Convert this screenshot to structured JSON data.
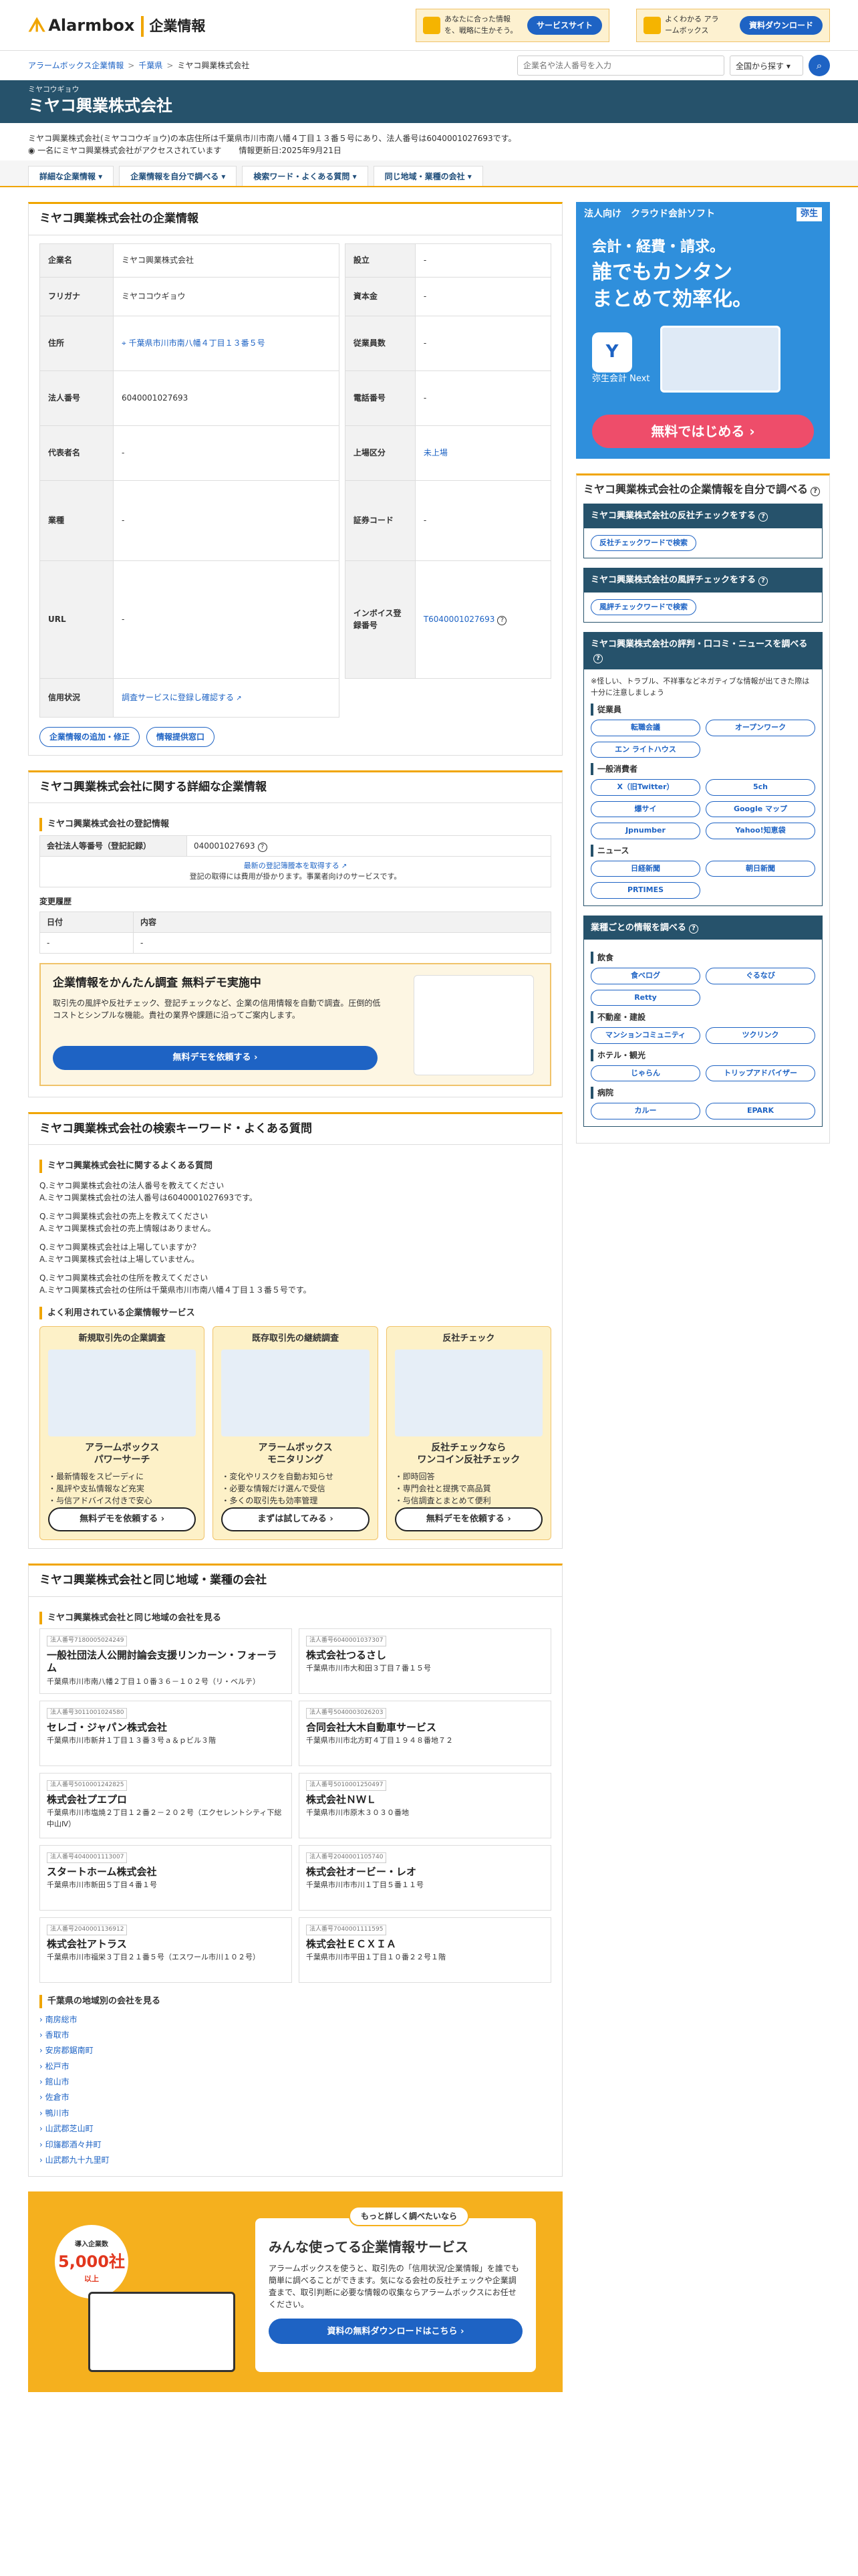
{
  "header": {
    "logo": "Alarmbox",
    "logo_sub": "企業情報",
    "banner1": {
      "text": "あなたに合った情報を、戦略に生かそう。",
      "btn": "サービスサイト"
    },
    "banner2": {
      "text": "よくわかる アラームボックス",
      "btn": "資料ダウンロード"
    }
  },
  "breadcrumb": [
    "アラームボックス企業情報",
    "千葉県",
    "ミヤコ興業株式会社"
  ],
  "search": {
    "placeholder": "企業名や法人番号を入力",
    "scope": "全国から探す ▾"
  },
  "company": {
    "kana": "ミヤコウギョウ",
    "name": "ミヤコ興業株式会社",
    "intro": "ミヤコ興業株式会社(ミヤココウギョウ)の本店住所は千葉県市川市南八幡４丁目１３番５号にあり、法人番号は6040001027693です。",
    "access": "一名にミヤコ興業株式会社がアクセスされています",
    "updated": "情報更新日:2025年9月21日"
  },
  "tabs": [
    "詳細な企業情報 ▾",
    "企業情報を自分で調べる ▾",
    "検索ワード・よくある質問 ▾",
    "同じ地域・業種の会社 ▾"
  ],
  "info": {
    "title": "ミヤコ興業株式会社の企業情報",
    "left": [
      [
        "企業名",
        "ミヤコ興業株式会社"
      ],
      [
        "フリガナ",
        "ミヤココウギョウ"
      ],
      [
        "住所",
        "千葉県市川市南八幡４丁目１３番５号"
      ],
      [
        "法人番号",
        "6040001027693"
      ],
      [
        "代表者名",
        "-"
      ],
      [
        "業種",
        "-"
      ],
      [
        "URL",
        "-"
      ],
      [
        "信用状況",
        "調査サービスに登録し確認する"
      ]
    ],
    "right": [
      [
        "設立",
        "-"
      ],
      [
        "資本金",
        "-"
      ],
      [
        "従業員数",
        "-"
      ],
      [
        "電話番号",
        "-"
      ],
      [
        "上場区分",
        "未上場"
      ],
      [
        "証券コード",
        "-"
      ],
      [
        "インボイス登録番号",
        "T6040001027693"
      ]
    ],
    "btn_edit": "企業情報の追加・修正",
    "btn_provide": "情報提供窓口"
  },
  "ad": {
    "tag": "法人向け　クラウド会計ソフト",
    "brand": "弥生",
    "line1": "会計・経費・請求。",
    "line2": "誰でもカンタン",
    "line3": "まとめて効率化。",
    "app": "弥生会計 Next",
    "cta": "無料ではじめる ›"
  },
  "detail": {
    "title": "ミヤコ興業株式会社に関する詳細な企業情報",
    "reg_title": "ミヤコ興業株式会社の登記情報",
    "reg_key": "会社法人等番号（登記記録）",
    "reg_val": "040001027693",
    "reg_link": "最新の登記簿謄本を取得する",
    "reg_note": "登記の取得には費用が掛かります。事業者向けのサービスです。",
    "hist_title": "変更履歴",
    "hist_cols": [
      "日付",
      "内容"
    ],
    "hist_row": [
      "-",
      "-"
    ],
    "demo_title": "企業情報をかんたん調査 無料デモ実施中",
    "demo_text": "取引先の風評や反社チェック、登記チェックなど、企業の信用情報を自動で調査。圧倒的低コストとシンプルな機能。貴社の業界や課題に沿ってご案内します。",
    "demo_btn": "無料デモを依頼する ›"
  },
  "faq": {
    "title": "ミヤコ興業株式会社の検索キーワード・よくある質問",
    "sub": "ミヤコ興業株式会社に関するよくある質問",
    "qa": [
      [
        "Q.ミヤコ興業株式会社の法人番号を教えてください",
        "A.ミヤコ興業株式会社の法人番号は6040001027693です。"
      ],
      [
        "Q.ミヤコ興業株式会社の売上を教えてください",
        "A.ミヤコ興業株式会社の売上情報はありません。"
      ],
      [
        "Q.ミヤコ興業株式会社は上場していますか？",
        "A.ミヤコ興業株式会社は上場していません。"
      ],
      [
        "Q.ミヤコ興業株式会社の住所を教えてください",
        "A.ミヤコ興業株式会社の住所は千葉県市川市南八幡４丁目１３番５号です。"
      ]
    ],
    "svc_title": "よく利用されている企業情報サービス",
    "svcs": [
      {
        "h": "新規取引先の企業調査",
        "n1": "アラームボックス",
        "n2": "パワーサーチ",
        "items": [
          "・最新情報をスピーディに",
          "・風評や支払情報など充実",
          "・与信アドバイス付きで安心"
        ],
        "b": "無料デモを依頼する ›"
      },
      {
        "h": "既存取引先の継続調査",
        "n1": "アラームボックス",
        "n2": "モニタリング",
        "items": [
          "・変化やリスクを自動お知らせ",
          "・必要な情報だけ選んで受信",
          "・多くの取引先も効率管理"
        ],
        "b": "まずは試してみる ›"
      },
      {
        "h": "反社チェック",
        "n1": "反社チェックなら",
        "n2": "ワンコイン反社チェック",
        "items": [
          "・即時回答",
          "・専門会社と提携で高品質",
          "・与信調査とまとめて便利"
        ],
        "b": "無料デモを依頼する ›"
      }
    ]
  },
  "peers": {
    "title": "ミヤコ興業株式会社と同じ地域・業種の会社",
    "sub": "ミヤコ興業株式会社と同じ地域の会社を見る",
    "cards": [
      {
        "no": "法人番号7180005024249",
        "nm": "一般社団法人公開討論会支援リンカーン・フォーラム",
        "ad": "千葉県市川市南八幡２丁目１０番３６－１０２号（リ・ベルテ）"
      },
      {
        "no": "法人番号6040001037307",
        "nm": "株式会社つるさし",
        "ad": "千葉県市川市大和田３丁目７番１５号"
      },
      {
        "no": "法人番号3011001024580",
        "nm": "セレゴ・ジャパン株式会社",
        "ad": "千葉県市川市新井１丁目１３番３号ａ＆ｐビル３階"
      },
      {
        "no": "法人番号5040003026203",
        "nm": "合同会社大木自動車サービス",
        "ad": "千葉県市川市北方町４丁目１９４８番地７２"
      },
      {
        "no": "法人番号5010001242825",
        "nm": "株式会社プエプロ",
        "ad": "千葉県市川市塩焼２丁目１２番２－２０２号（エクセレントシティ下総中山Ⅳ）"
      },
      {
        "no": "法人番号5010001250497",
        "nm": "株式会社ＮＷＬ",
        "ad": "千葉県市川市原木３０３０番地"
      },
      {
        "no": "法人番号4040001113007",
        "nm": "スタートホーム株式会社",
        "ad": "千葉県市川市新田５丁目４番１号"
      },
      {
        "no": "法人番号2040001105740",
        "nm": "株式会社オービー・レオ",
        "ad": "千葉県市川市市川１丁目５番１１号"
      },
      {
        "no": "法人番号2040001136912",
        "nm": "株式会社アトラス",
        "ad": "千葉県市川市福栄３丁目２１番５号（エスワール市川１０２号）"
      },
      {
        "no": "法人番号7040001111595",
        "nm": "株式会社ＥＣＸＩＡ",
        "ad": "千葉県市川市平田１丁目１０番２２号１階"
      }
    ],
    "area_title": "千葉県の地域別の会社を見る",
    "areas": [
      "南房総市",
      "香取市",
      "安房郡鋸南町",
      "松戸市",
      "館山市",
      "佐倉市",
      "鴨川市",
      "山武郡芝山町",
      "印旛郡酒々井町",
      "山武郡九十九里町"
    ]
  },
  "promo": {
    "tag": "もっと詳しく調べたいなら",
    "badge1": "導入企業数",
    "badge2": "5,000社",
    "badge3": "以上",
    "title": "みんな使ってる企業情報サービス",
    "text": "アラームボックスを使うと、取引先の「信用状況/企業情報」を誰でも簡単に調べることができます。気になる会社の反社チェックや企業調査まで、取引判断に必要な情報の収集ならアラームボックスにお任せください。",
    "btn": "資料の無料ダウンロードはこちら ›"
  },
  "side": {
    "title": "ミヤコ興業株式会社の企業情報を自分で調べる",
    "c1": {
      "h": "ミヤコ興業株式会社の反社チェックをする",
      "b": "反社チェックワードで検索"
    },
    "c2": {
      "h": "ミヤコ興業株式会社の風評チェックをする",
      "b": "風評チェックワードで検索"
    },
    "c3": {
      "h": "ミヤコ興業株式会社の評判・口コミ・ニュースを調べる",
      "note": "※怪しい、トラブル、不祥事などネガティブな情報が出てきた際は十分に注意しましょう",
      "g1": "従業員",
      "g1b": [
        "転職会議",
        "オープンワーク",
        "エン ライトハウス"
      ],
      "g2": "一般消費者",
      "g2b": [
        "X（旧Twitter）",
        "5ch",
        "爆サイ",
        "Google マップ",
        "Jpnumber",
        "Yahoo!知恵袋"
      ],
      "g3": "ニュース",
      "g3b": [
        "日経新聞",
        "朝日新聞",
        "PRTIMES"
      ]
    },
    "c4": {
      "h": "業種ごとの情報を調べる",
      "g1": "飲食",
      "g1b": [
        "食べログ",
        "ぐるなび",
        "Retty"
      ],
      "g2": "不動産・建設",
      "g2b": [
        "マンションコミュニティ",
        "ツクリンク"
      ],
      "g3": "ホテル・観光",
      "g3b": [
        "じゃらん",
        "トリップアドバイザー"
      ],
      "g4": "病院",
      "g4b": [
        "カルー",
        "EPARK"
      ]
    }
  }
}
